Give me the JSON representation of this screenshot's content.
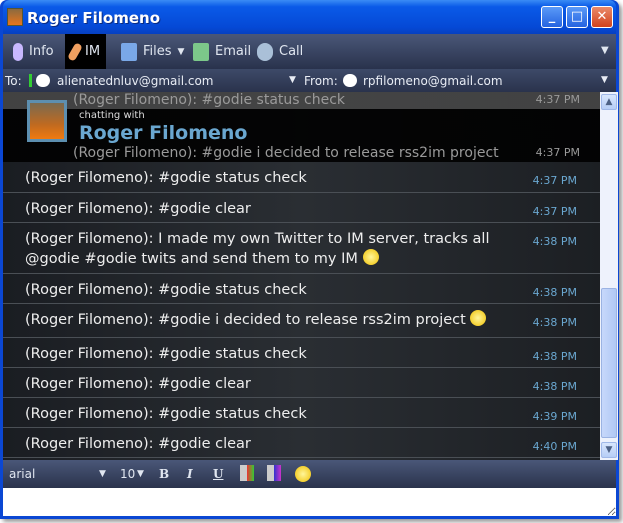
{
  "window": {
    "title": "Roger Filomeno"
  },
  "toolbar": {
    "items": [
      {
        "label": "Info",
        "icon": "lightbulb-icon"
      },
      {
        "label": "IM",
        "icon": "pencil-icon",
        "selected": true
      },
      {
        "label": "Files",
        "icon": "files-icon"
      },
      {
        "label": "Email",
        "icon": "email-icon"
      },
      {
        "label": "Call",
        "icon": "webcam-icon"
      }
    ]
  },
  "address": {
    "to_label": "To:",
    "to": "alienatednluv@gmail.com",
    "from_label": "From:",
    "from": "rpfilomeno@gmail.com"
  },
  "chat_header": {
    "chatting_with": "chatting with",
    "name": "Roger Filomeno"
  },
  "ghost_rows": [
    {
      "text": "(Roger Filomeno): #godie status check",
      "time": "4:37 PM"
    },
    {
      "text": "(Roger Filomeno): #godie i decided to release rss2im project",
      "time": "4:37 PM"
    }
  ],
  "messages": [
    {
      "text": "(Roger Filomeno): #godie status check",
      "time": "4:37 PM"
    },
    {
      "text": "(Roger Filomeno): #godie clear",
      "time": "4:37 PM"
    },
    {
      "text": "(Roger Filomeno): I made my own Twitter to IM server, tracks all @godie #godie twits and send them to my IM",
      "time": "4:38 PM",
      "emoji": true
    },
    {
      "text": "(Roger Filomeno): #godie status check",
      "time": "4:38 PM"
    },
    {
      "text": "(Roger Filomeno): #godie i decided to release rss2im project",
      "time": "4:38 PM",
      "emoji": true
    },
    {
      "text": "(Roger Filomeno): #godie status check",
      "time": "4:38 PM"
    },
    {
      "text": "(Roger Filomeno): #godie clear",
      "time": "4:38 PM"
    },
    {
      "text": "(Roger Filomeno): #godie status check",
      "time": "4:39 PM"
    },
    {
      "text": "(Roger Filomeno): #godie clear",
      "time": "4:40 PM"
    }
  ],
  "format": {
    "font": "arial",
    "size": "10",
    "bold": "B",
    "italic": "I",
    "underline": "U"
  },
  "input": {
    "value": ""
  }
}
